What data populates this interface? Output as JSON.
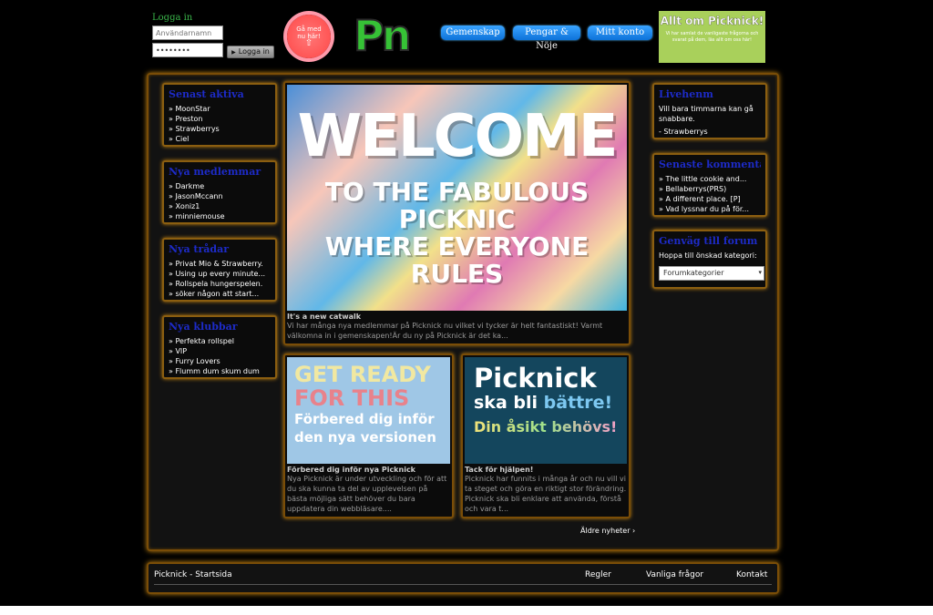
{
  "login": {
    "title": "Logga in",
    "username_placeholder": "Användarnamn",
    "password_value": "••••••••",
    "button_label": "Logga in"
  },
  "join_badge": {
    "line1": "Gå med",
    "line2": "nu här!",
    "arrow": "⇧"
  },
  "logo": {
    "text": "Pn"
  },
  "nav": {
    "tabs": [
      {
        "label": "Gemenskap"
      },
      {
        "label": "Pengar & Nöje"
      },
      {
        "label": "Mitt konto"
      }
    ]
  },
  "ad": {
    "title": "Allt om Picknick!",
    "text": "Vi har samlat de vanligaste frågorna och svarat på dem, läs allt om oss här!"
  },
  "sidebar_left": [
    {
      "title": "Senast aktiva",
      "items": [
        "» MoonStar",
        "» Preston",
        "» Strawberrys",
        "» Ciel"
      ]
    },
    {
      "title": "Nya medlemmar",
      "items": [
        "» Darkme",
        "» JasonMccann",
        "» Xoniz1",
        "» minniemouse"
      ]
    },
    {
      "title": "Nya trådar",
      "items": [
        "» Privat Mio & Strawberry.",
        "» Using up every minute...",
        "» Rollspela hungerspelen.",
        "» söker någon att start..."
      ]
    },
    {
      "title": "Nya klubbar",
      "items": [
        "» Perfekta rollspel",
        "» VIP",
        "» Furry Lovers",
        "» Flumm dum skum dum"
      ]
    }
  ],
  "sidebar_right": {
    "box1": {
      "title": "Livehenm",
      "text": "Vill bara timmarna kan gå snabbare.",
      "item": "- Strawberrys"
    },
    "box2": {
      "title": "Senaste kommentarer",
      "items": [
        "» The little cookie and...",
        "» Bellaberrys(PRS)",
        "» A different place. [P]",
        "» Vad lyssnar du på för..."
      ]
    },
    "box3": {
      "title": "Genväg till forum",
      "text": "Hoppa till önskad kategori:",
      "select_value": "Forumkategorier"
    }
  },
  "news": {
    "main": {
      "img_big": "WELCOME",
      "img_sub1": "TO THE FABULOUS PICKNIC",
      "img_sub2": "WHERE EVERYONE RULES",
      "title": "It's a new catwalk",
      "desc": "Vi har många nya medlemmar på Picknick nu vilket vi tycker är helt fantastiskt! Varmt välkomna in i gemenskapen!Är du ny på Picknick är det ka..."
    },
    "left": {
      "img_l1": "GET READY",
      "img_l2": "FOR THIS",
      "img_l3": "Förbered dig inför",
      "img_l4": "den nya versionen",
      "title": "Förbered dig inför nya Picknick",
      "desc": "Nya Picknick är under utveckling och för att du ska kunna ta del av upplevelsen på bästa möjliga sätt behöver du bara uppdatera din webbläsare...."
    },
    "right": {
      "img_l1": "Picknick",
      "img_l2a": "ska bli",
      "img_l2b": "bättre!",
      "img_l3": "Din åsikt behövs!",
      "title": "Tack för hjälpen!",
      "desc": "Picknick har funnits i många år och nu vill vi ta steget och göra en riktigt stor förändring. Picknick ska bli enklare att använda, förstå och vara t..."
    },
    "older_link": "Äldre nyheter ›"
  },
  "footer": {
    "home": "Picknick - Startsida",
    "rules": "Regler",
    "faq": "Vanliga frågor",
    "contact": "Kontakt"
  }
}
